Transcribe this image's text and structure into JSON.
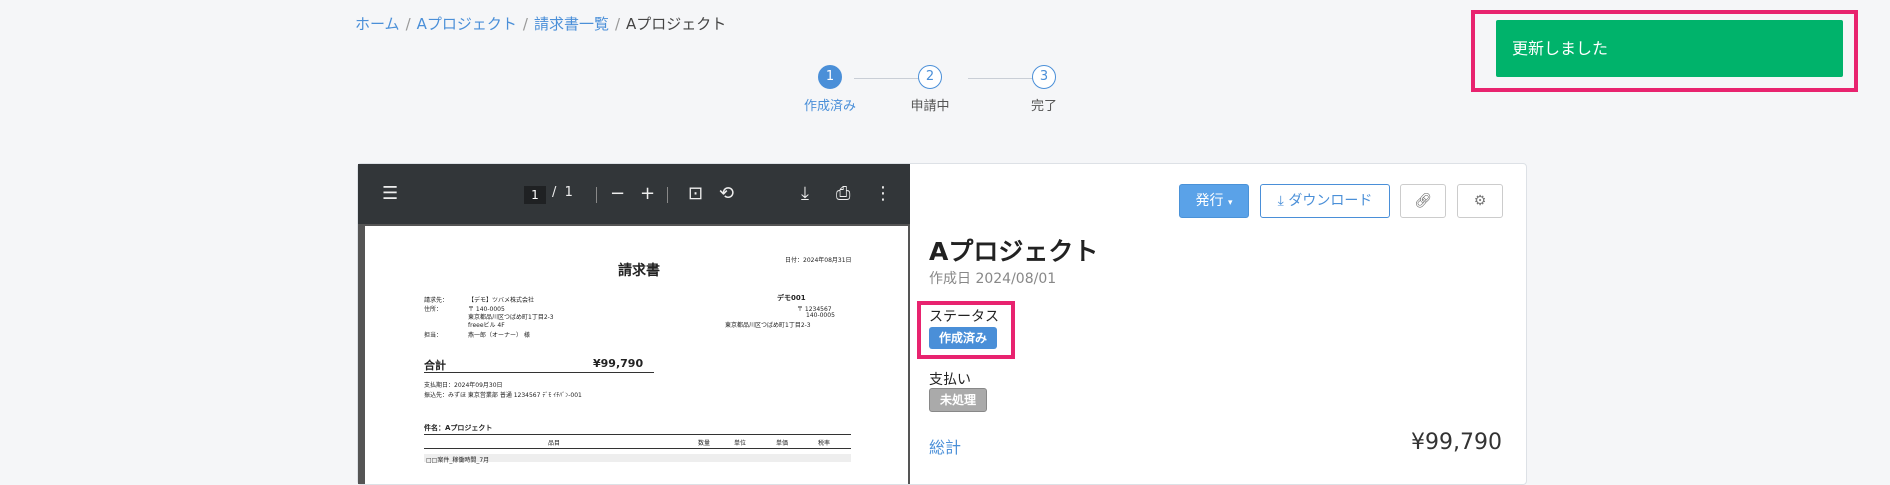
{
  "breadcrumb": {
    "items": [
      "ホーム",
      "Aプロジェクト",
      "請求書一覧"
    ],
    "current": "Aプロジェクト",
    "separator": "/"
  },
  "stepper": {
    "steps": [
      {
        "number": "1",
        "label": "作成済み",
        "active": true
      },
      {
        "number": "2",
        "label": "申請中",
        "active": false
      },
      {
        "number": "3",
        "label": "完了",
        "active": false
      }
    ]
  },
  "toast": {
    "message": "更新しました",
    "color": "#00b36b"
  },
  "viewer": {
    "page_current": "1",
    "page_total": "1",
    "separator": "/",
    "icons": [
      "menu-icon",
      "zoom-out-icon",
      "zoom-in-icon",
      "fit-page-icon",
      "rotate-icon",
      "download-icon",
      "print-icon",
      "more-icon"
    ],
    "document": {
      "title": "請求書",
      "date": "日付：2024年08月31日",
      "to_label": "請求先：",
      "to_value": "【デモ】ツバメ株式会社",
      "address_label": "住所：",
      "address_lines": [
        "〒 140-0005",
        "東京都品川区つばめ町1丁目2-3",
        "freeeビル 4F"
      ],
      "attn_label": "担当：",
      "attn_value": "燕一郎（オーナー） 様",
      "issuer_name": "デモ001",
      "issuer_lines": [
        "〒 1234567",
        "140-0005",
        "東京都品川区つばめ町1丁目2-3"
      ],
      "total_label": "合計",
      "total_value": "¥99,790",
      "due": "支払期日：2024年09月30日",
      "bank": "振込先：みずほ 東京営業部 普通 1234567 ﾃﾞﾓ ｲﾁﾊﾞﾝ-001",
      "subject": "件名：Aプロジェクト",
      "columns": [
        "品目",
        "数量",
        "単位",
        "単価",
        "税率"
      ],
      "rows": [
        "□□案件_稼働時間_7月"
      ]
    }
  },
  "panel": {
    "issue_button": "発行",
    "download_button": "ダウンロード",
    "title": "Aプロジェクト",
    "created": "作成日 2024/08/01",
    "status_label": "ステータス",
    "status_value": "作成済み",
    "payment_label": "支払い",
    "payment_value": "未処理",
    "total_label": "総計",
    "total_value": "¥99,790"
  },
  "colors": {
    "accent": "#4a8fd8",
    "highlight": "#e8236f",
    "success": "#00b36b"
  }
}
